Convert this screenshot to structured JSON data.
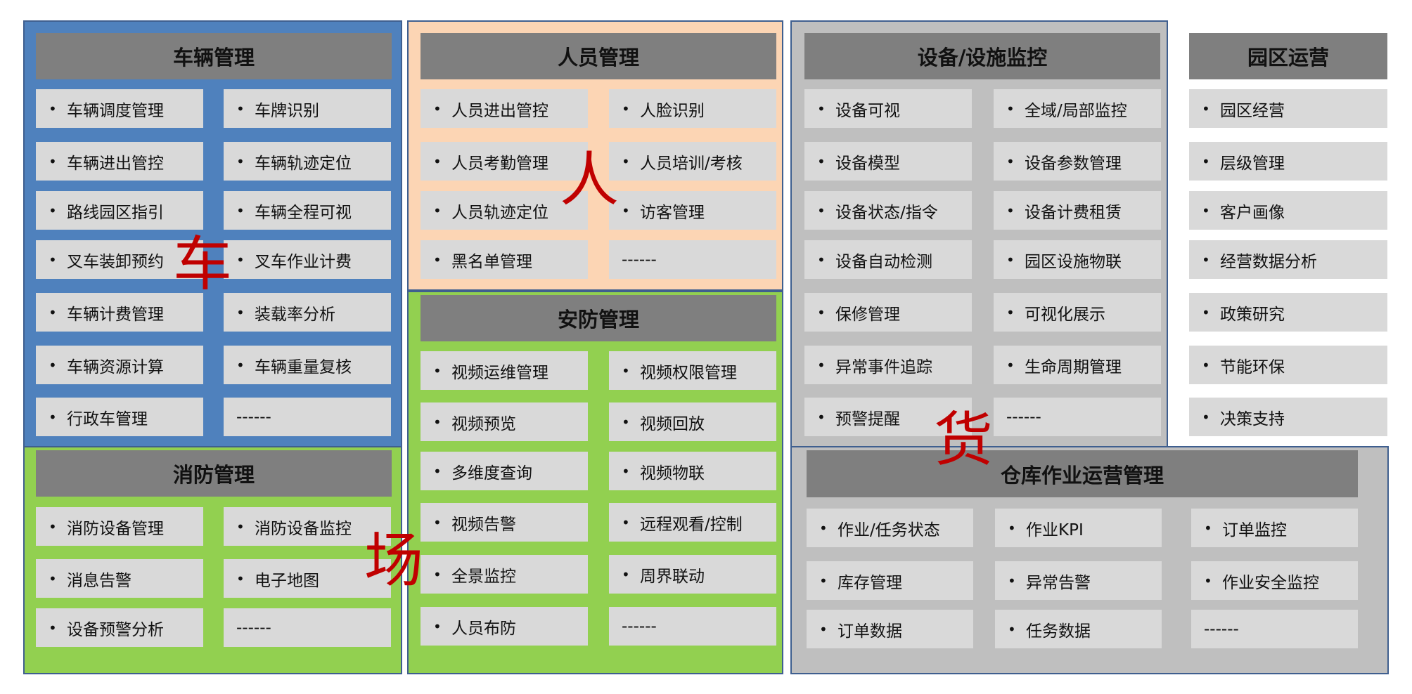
{
  "panels": {
    "vehicle": {
      "title": "车辆管理",
      "items": [
        "车辆调度管理",
        "车牌识别",
        "车辆进出管控",
        "车辆轨迹定位",
        "路线园区指引",
        "车辆全程可视",
        "叉车装卸预约",
        "叉车作业计费",
        "车辆计费管理",
        "装载率分析",
        "车辆资源计算",
        "车辆重量复核",
        "行政车管理",
        "------"
      ]
    },
    "personnel": {
      "title": "人员管理",
      "items": [
        "人员进出管控",
        "人脸识别",
        "人员考勤管理",
        "人员培训/考核",
        "人员轨迹定位",
        "访客管理",
        "黑名单管理",
        "------"
      ]
    },
    "equipment": {
      "title": "设备/设施监控",
      "items": [
        "设备可视",
        "全域/局部监控",
        "设备模型",
        "设备参数管理",
        "设备状态/指令",
        "设备计费租赁",
        "设备自动检测",
        "园区设施物联",
        "保修管理",
        "可视化展示",
        "异常事件追踪",
        "生命周期管理",
        "预警提醒",
        "------"
      ]
    },
    "park": {
      "title": "园区运营",
      "items": [
        "园区经营",
        "层级管理",
        "客户画像",
        "经营数据分析",
        "政策研究",
        "节能环保",
        "决策支持"
      ]
    },
    "security": {
      "title": "安防管理",
      "items": [
        "视频运维管理",
        "视频权限管理",
        "视频预览",
        "视频回放",
        "多维度查询",
        "视频物联",
        "视频告警",
        "远程观看/控制",
        "全景监控",
        "周界联动",
        "人员布防",
        "------"
      ]
    },
    "fire": {
      "title": "消防管理",
      "items": [
        "消防设备管理",
        "消防设备监控",
        "消息告警",
        "电子地图",
        "设备预警分析",
        "------"
      ]
    },
    "warehouse": {
      "title": "仓库作业运营管理",
      "items": [
        "作业/任务状态",
        "作业KPI",
        "订单监控",
        "库存管理",
        "异常告警",
        "作业安全监控",
        "订单数据",
        "任务数据",
        "------"
      ]
    }
  },
  "big_labels": {
    "che": "车",
    "ren": "人",
    "chang": "场",
    "huo": "货"
  },
  "bullet": "•",
  "colors": {
    "vehicle_bg": "#4f81bd",
    "personnel_bg": "#fcd5b4",
    "green_bg": "#92d050",
    "gray_bg": "#bfbfbf",
    "header": "#7f7f7f",
    "item": "#d9d9d9",
    "big_text": "#c00000"
  }
}
